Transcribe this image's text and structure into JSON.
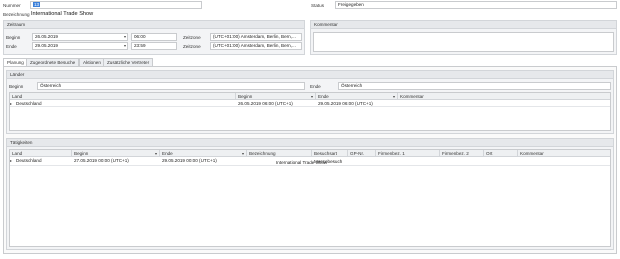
{
  "header": {
    "nummer_label": "Nummer",
    "nummer_value": "13",
    "status_label": "Status",
    "status_value": "Freigegeben",
    "bezeichnung_label": "Bezeichnung",
    "bezeichnung_value": "International Trade Show"
  },
  "zeitraum": {
    "title": "Zeitraum",
    "beginn_label": "Beginn",
    "beginn_date": "26.05.2019",
    "beginn_time": "06:00",
    "ende_label": "Ende",
    "ende_date": "29.05.2019",
    "ende_time": "23:59",
    "zeitzone_label_1": "Zeitzone",
    "zeitzone_value_1": "(UTC+01:00) Amsterdam, Berlin, Bern,...",
    "zeitzone_label_2": "Zeitzone",
    "zeitzone_value_2": "(UTC+01:00) Amsterdam, Berlin, Bern,..."
  },
  "kommentar": {
    "title": "Kommentar",
    "value": ""
  },
  "tabs": [
    {
      "label": "Planung"
    },
    {
      "label": "Zugeordnete Besuche"
    },
    {
      "label": "Aktionen"
    },
    {
      "label": "Zusätzliche Vertreter"
    }
  ],
  "laender": {
    "title": "Länder",
    "beginn_label": "Beginn",
    "beginn_value": "Österreich",
    "ende_label": "Ende",
    "ende_value": "Österreich",
    "columns": [
      "Land",
      "Beginn",
      "Ende",
      "Kommentar"
    ],
    "rows": [
      {
        "land": "Deutschland",
        "beginn": "26.05.2019 06:00 (UTC+1)",
        "ende": "29.05.2019 06:00 (UTC+1)",
        "kommentar": ""
      }
    ]
  },
  "taetigkeiten": {
    "title": "Tätigkeiten",
    "columns": [
      "Land",
      "Beginn",
      "Ende",
      "Bezeichnung",
      "Besuchsart",
      "GP-Nr.",
      "Firmenbez. 1",
      "Firmenbez. 2",
      "Ort",
      "Kommentar"
    ],
    "rows": [
      {
        "land": "Deutschland",
        "beginn": "27.05.2019 00:00 (UTC+1)",
        "ende": "29.05.2019 00:00 (UTC+1)",
        "bezeichnung": "International Trade Show",
        "besuchsart": "Messebesuch",
        "gpnr": "",
        "firmenbez1": "",
        "firmenbez2": "",
        "ort": "",
        "kommentar": ""
      }
    ]
  },
  "colors": {
    "accent": "#3b7fd9",
    "group_bg": "#f3f4f6",
    "header_bg": "#e6e8eb",
    "border": "#c9cbce"
  }
}
